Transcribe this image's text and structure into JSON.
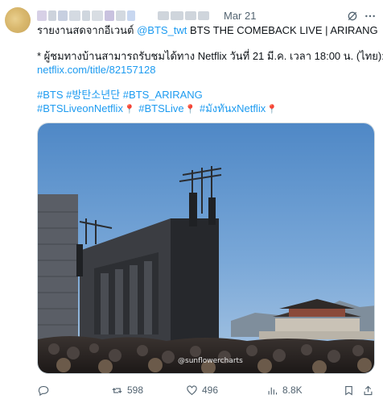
{
  "tweet": {
    "date": "Mar 21",
    "line1_prefix": "รายงานสดจากอีเวนต์ ",
    "line1_mention": "@BTS_twt",
    "line1_suffix": " BTS THE COMEBACK LIVE | ARIRANG",
    "line2": "* ผู้ชมทางบ้านสามารถรับชมได้ทาง Netflix วันที่ 21 มี.ค. เวลา 18:00 น. (ไทย):",
    "link": "netflix.com/title/82157128",
    "hashtags_line1": [
      "#BTS",
      "#방탄소년단",
      "#BTS_ARIRANG"
    ],
    "hashtags_line2": [
      "#BTSLiveonNetflix",
      "#BTSLive",
      "#มังทันxNetflix"
    ],
    "pin_icon": "round-pushpin-icon"
  },
  "media": {
    "watermark": "@sunflowercharts"
  },
  "actions": {
    "reply_count": "",
    "retweet_count": "598",
    "like_count": "496",
    "views_count": "8.8K"
  },
  "colors": {
    "link": "#1d9bf0",
    "muted": "#536471",
    "text": "#0f1419"
  }
}
